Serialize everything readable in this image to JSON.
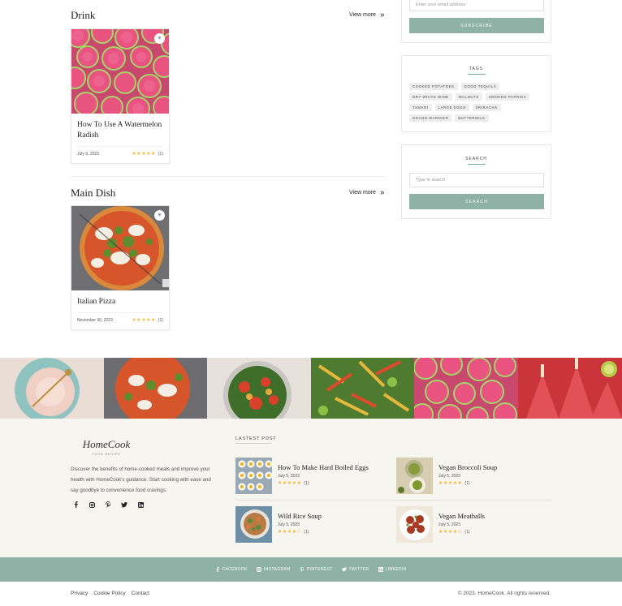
{
  "sections": [
    {
      "title": "Drink",
      "view_more": "View more",
      "card": {
        "title": "How To Use A Watermelon Radish",
        "date": "July 9, 2023",
        "rating": "★★★★★",
        "rating_count": "(1)"
      }
    },
    {
      "title": "Main Dish",
      "view_more": "View more",
      "card": {
        "title": "Italian Pizza",
        "date": "November 30, 2023",
        "rating": "★★★★★",
        "rating_count": "(1)"
      }
    }
  ],
  "subscribe": {
    "email_placeholder": "Enter your email address",
    "button": "SUBSCRIBE"
  },
  "tags": {
    "title": "TAGS",
    "items": [
      "COOKED POTATOES",
      "GOOD TEQUILA",
      "DRY WHITE WINE",
      "WALNUTS",
      "SMOKED PAPRIKA",
      "TAMARI",
      "LARGE EGGS",
      "SRIRACHA",
      "GRAND MARNIER",
      "BUTTERMILK"
    ]
  },
  "search": {
    "title": "SEARCH",
    "placeholder": "Type to search",
    "button": "SEARCH"
  },
  "footer": {
    "logo_text": "HomeCook",
    "logo_sub": "FOOD RECIPE",
    "description": "Discover the benefits of home-cooked meals and improve your health with HomeCook's guidance. Start cooking with ease and say goodbye to convenience food cravings.",
    "latest_title": "LASTEST POST",
    "posts": [
      {
        "title": "How To Make Hard Boiled Eggs",
        "date": "July 5, 2023",
        "rating": "★★★★★",
        "count": "(1)"
      },
      {
        "title": "Vegan Broccoli Soup",
        "date": "July 5, 2023",
        "rating": "★★★★★",
        "count": "(1)"
      },
      {
        "title": "Wild Rice Soup",
        "date": "July 5, 2023",
        "rating": "★★★★☆",
        "count": "(1)"
      },
      {
        "title": "Vegan Meatballs",
        "date": "July 5, 2023",
        "rating": "★★★★☆",
        "count": "(1)"
      }
    ],
    "social_bar": [
      "FACEBOOK",
      "INSTAGRAM",
      "PINTEREST",
      "TWITTER",
      "LINKEDIN"
    ],
    "links": [
      "Privacy",
      "Cookie Policy",
      "Contact"
    ],
    "copyright": "© 2023. HomeCook. All rights reserved."
  },
  "colors": {
    "accent": "#8fb2a7",
    "stars": "#f5b731",
    "footer_bg": "#f7f5f0"
  }
}
